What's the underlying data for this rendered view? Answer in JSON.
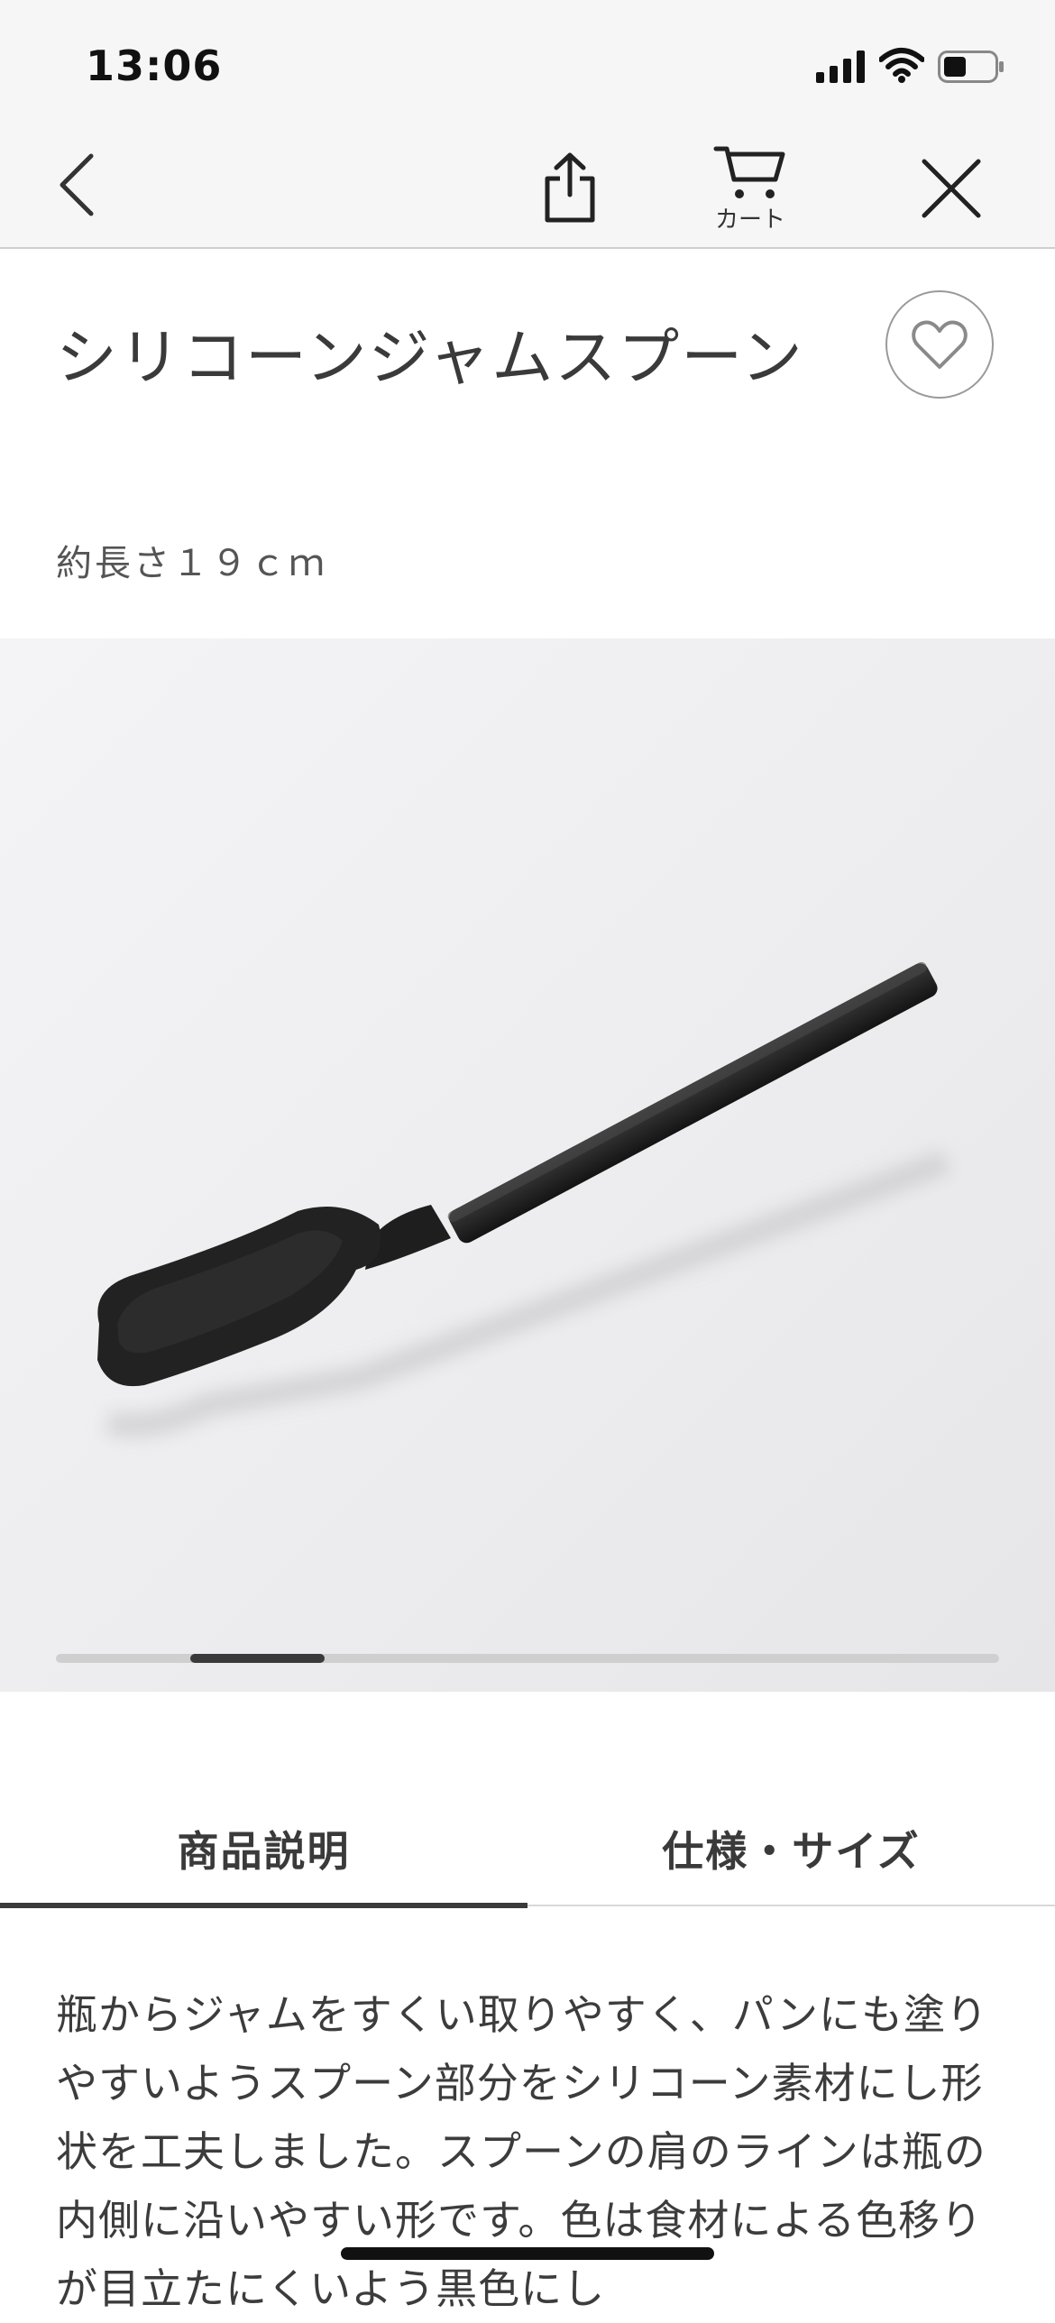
{
  "status_bar": {
    "time": "13:06",
    "battery_level": 0.45
  },
  "nav": {
    "back_icon": "chevron-left-icon",
    "share_icon": "share-icon",
    "cart_icon": "cart-icon",
    "cart_label": "カート",
    "close_icon": "close-icon"
  },
  "product": {
    "title": "シリコーンジャムスプーン",
    "subtitle": "約長さ１９ｃｍ",
    "favorite_icon": "heart-icon"
  },
  "gallery": {
    "current_image": 2,
    "image_count": 7
  },
  "tabs": [
    {
      "label": "商品説明",
      "active": true
    },
    {
      "label": "仕様・サイズ",
      "active": false
    }
  ],
  "description": "瓶からジャムをすくい取りやすく、パンにも塗りやすいようスプーン部分をシリコーン素材にし形状を工夫しました。スプーンの肩のラインは瓶の内側に沿いやすい形です。色は食材による色移りが目立たにくいよう黒色にし",
  "colors": {
    "accent": "#3a3a3a",
    "bar_bg": "#f6f6f6",
    "divider": "#cfcfcf"
  }
}
